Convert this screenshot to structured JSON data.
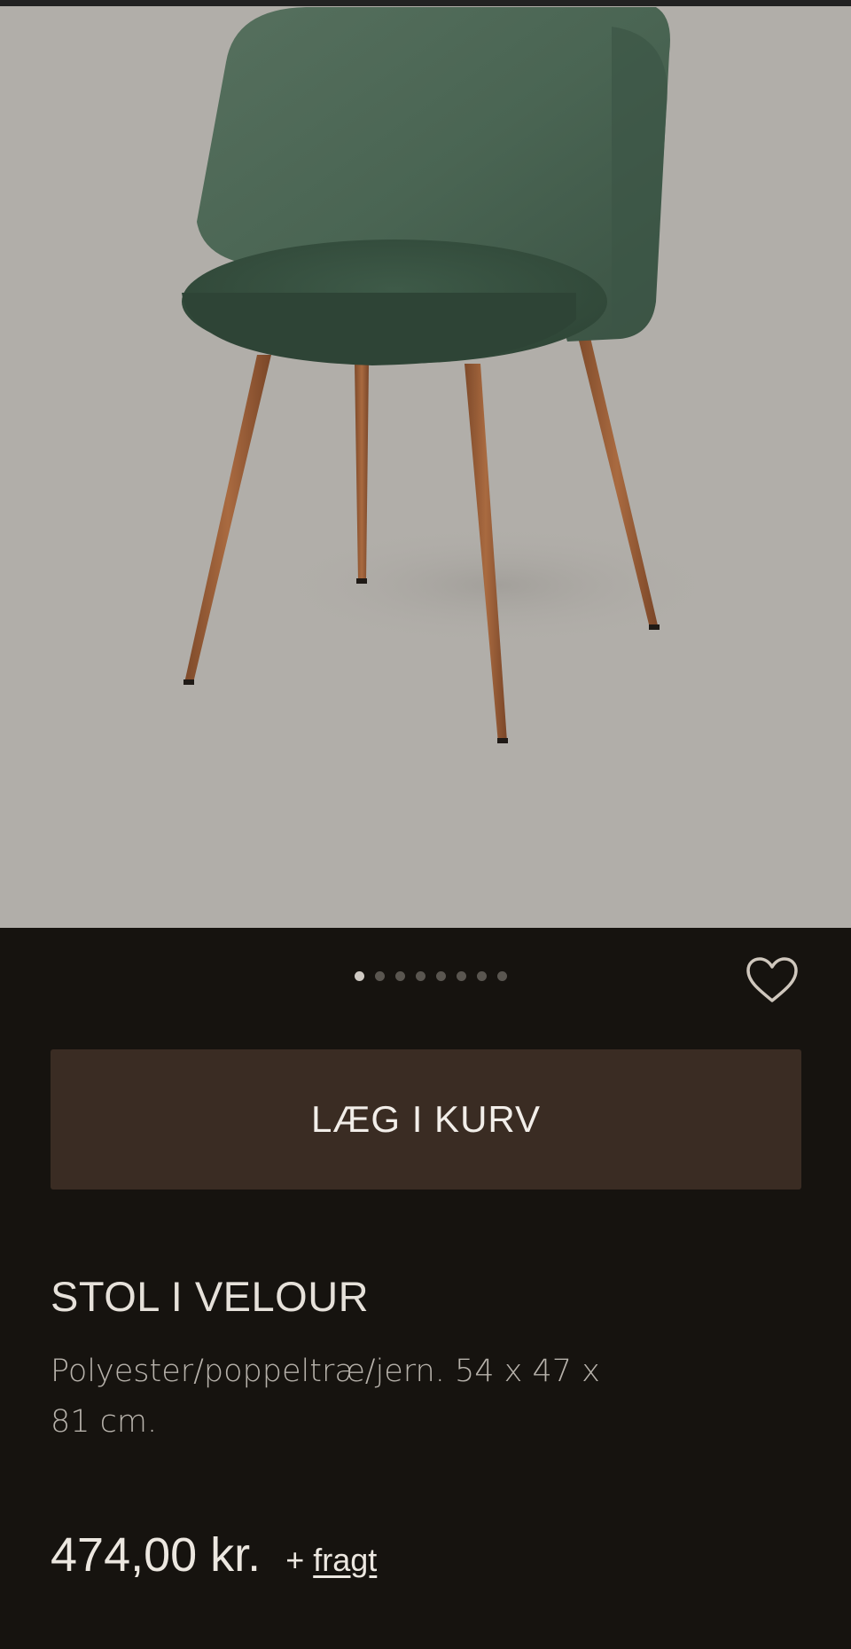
{
  "product": {
    "image_alt": "Grøn velourstol med træben",
    "carousel": {
      "count": 8,
      "active_index": 0
    },
    "favorite_icon": "heart-outline-icon",
    "add_to_cart_label": "LÆG I KURV",
    "title": "STOL I VELOUR",
    "description": "Polyester/poppeltræ/jern. 54 x 47 x 81 cm.",
    "price": "474,00 kr.",
    "price_plus": "+",
    "freight_link": "fragt"
  },
  "colors": {
    "background": "#16130f",
    "button": "#3a2c23",
    "image_bg": "#b1aea9",
    "velvet": "#3f5a49",
    "wood": "#9a5d36"
  }
}
